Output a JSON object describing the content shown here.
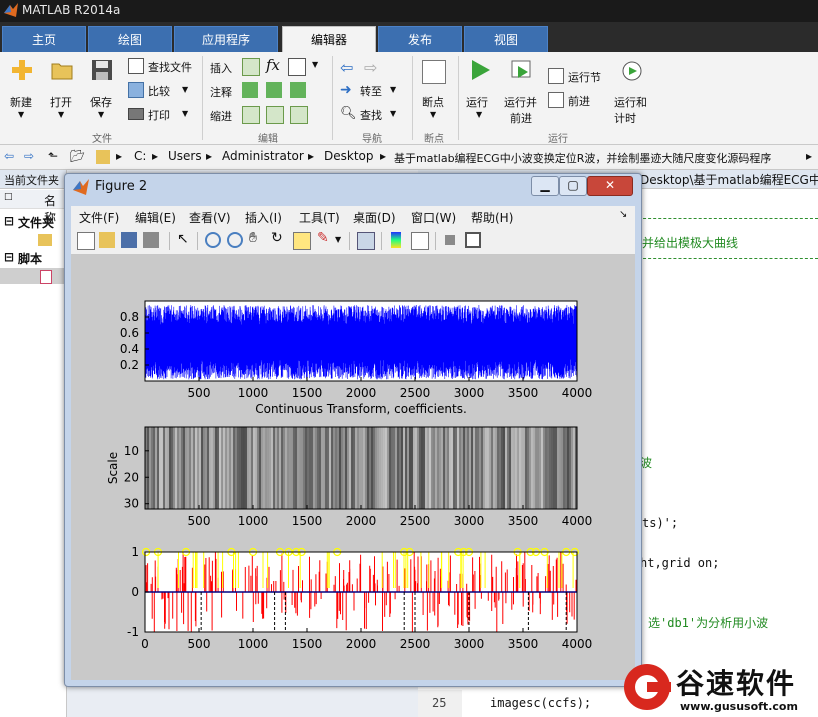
{
  "app_title": "MATLAB R2014a",
  "tabs": [
    "主页",
    "绘图",
    "应用程序",
    "编辑器",
    "发布",
    "视图"
  ],
  "active_tab": "编辑器",
  "ribbon": {
    "file": {
      "new": "新建",
      "open": "打开",
      "save": "保存",
      "find_files": "查找文件",
      "compare": "比较",
      "print": "打印",
      "group": "文件"
    },
    "edit": {
      "insert": "插入",
      "comment": "注释",
      "indent": "缩进",
      "group": "编辑"
    },
    "navigate": {
      "goto": "转至",
      "find": "查找",
      "group": "导航"
    },
    "breakpoints": {
      "label": "断点",
      "group": "断点"
    },
    "run": {
      "run": "运行",
      "run_advance_1": "运行并",
      "run_advance_2": "前进",
      "run_section": "运行节",
      "advance": "前进",
      "run_time_1": "运行和",
      "run_time_2": "计时",
      "group": "运行"
    }
  },
  "address": {
    "crumbs": [
      "C:",
      "Users",
      "Administrator",
      "Desktop",
      "基于matlab编程ECG中小波变换定位R波，并绘制墨迹大随尺度变化源码程序"
    ]
  },
  "left_panel": {
    "header": "当前文件夹",
    "name_col": "名称",
    "folder_section": "文件夹",
    "script_section": "脚本"
  },
  "editor": {
    "path_tail": "Desktop\\基于matlab编程ECG中小",
    "lines": [
      {
        "text": "并给出模极大曲线",
        "color": "#228b22"
      },
      {
        "text": "波",
        "color": "#228b22"
      },
      {
        "text": "ts)';",
        "color": "#000000"
      },
      {
        "text": "ht,grid on;",
        "color": "#000000"
      },
      {
        "text": "选'db1'为分析用小波",
        "color": "#228b22"
      },
      {
        "text": "imagesc(ccfs);",
        "color": "#000000"
      }
    ],
    "line_number": "25"
  },
  "figure": {
    "title": "Figure 2",
    "menu": [
      "文件(F)",
      "编辑(E)",
      "查看(V)",
      "插入(I)",
      "工具(T)",
      "桌面(D)",
      "窗口(W)",
      "帮助(H)"
    ],
    "toolbar_icons": [
      "new-figure-icon",
      "open-file-icon",
      "save-figure-icon",
      "print-figure-icon",
      "pointer-icon",
      "zoom-in-icon",
      "zoom-out-icon",
      "pan-icon",
      "rotate-icon",
      "data-cursor-icon",
      "brush-icon",
      "link-plot-icon",
      "colorbar-icon",
      "legend-icon",
      "hide-plot-tools-icon",
      "show-plot-tools-icon"
    ]
  },
  "chart_data": [
    {
      "type": "line",
      "title": "",
      "xlim": [
        0,
        4000
      ],
      "ylim": [
        0,
        1
      ],
      "xticks": [
        500,
        1000,
        1500,
        2000,
        2500,
        3000,
        3500,
        4000
      ],
      "yticks": [
        0.2,
        0.4,
        0.6,
        0.8
      ],
      "xtick_labels": [
        "500",
        "1000",
        "1500",
        "2000",
        "2500",
        "3000",
        "3500",
        "4000"
      ],
      "ytick_labels": [
        "0.2",
        "0.4",
        "0.6",
        "0.8"
      ],
      "series_color": "#0000ff",
      "description_values": {
        "x_start": 1,
        "x_end": 4000,
        "y_min": 0.0,
        "y_max": 0.95
      }
    },
    {
      "type": "heatmap",
      "title": "Continuous Transform, coefficients.",
      "ylabel": "Scale",
      "xlim": [
        0,
        4000
      ],
      "ylim": [
        1,
        32
      ],
      "xticks": [
        500,
        1000,
        1500,
        2000,
        2500,
        3000,
        3500,
        4000
      ],
      "yticks": [
        10,
        20,
        30
      ],
      "xtick_labels": [
        "500",
        "1000",
        "1500",
        "2000",
        "2500",
        "3000",
        "3500",
        "4000"
      ],
      "ytick_labels": [
        "10",
        "20",
        "30"
      ],
      "colormap": "gray"
    },
    {
      "type": "line",
      "title": "",
      "xlim": [
        0,
        4000
      ],
      "ylim": [
        -1,
        1
      ],
      "xticks": [
        0,
        500,
        1000,
        1500,
        2000,
        2500,
        3000,
        3500,
        4000
      ],
      "yticks": [
        -1,
        0,
        1
      ],
      "xtick_labels": [
        "0",
        "500",
        "1000",
        "1500",
        "2000",
        "2500",
        "3000",
        "3500",
        "4000"
      ],
      "ytick_labels": [
        "-1",
        "0",
        "1"
      ],
      "series_colors": {
        "modulus_maxima": "#ff0000",
        "markers": "#ffff00",
        "reference": "#000000"
      },
      "marker_x": [
        10,
        120,
        380,
        800,
        1000,
        1250,
        1330,
        1400,
        1450,
        1780,
        2400,
        2450,
        2900,
        2950,
        3000,
        3450,
        3570,
        3620,
        3700,
        3900,
        3980
      ]
    }
  ],
  "watermark": {
    "brand": "谷速软件",
    "url": "www.gususoft.com"
  }
}
